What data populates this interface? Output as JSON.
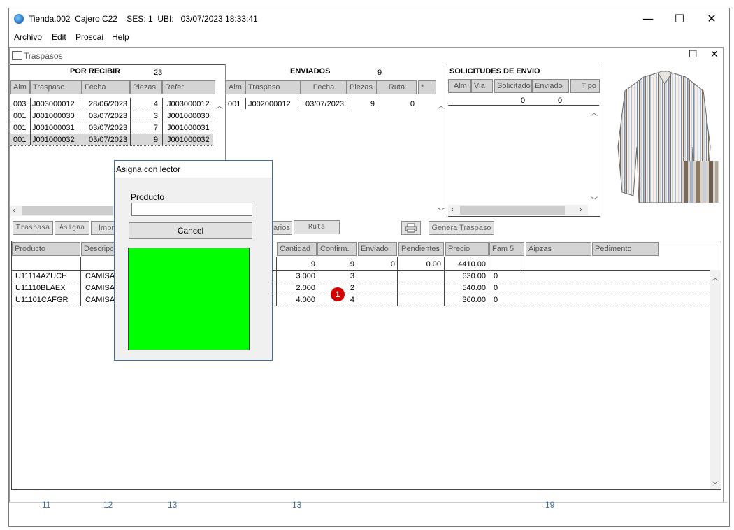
{
  "window": {
    "title": "Tienda.002  Cajero C22    SES: 1  UBI:   03/07/2023 18:33:41",
    "minimize": "—",
    "maximize": "☐",
    "close": "✕"
  },
  "menu": [
    "Archivo",
    "Edit",
    "Proscai",
    "Help"
  ],
  "child_window": {
    "title": "Traspasos",
    "maximize": "☐",
    "close": "✕"
  },
  "por_recibir": {
    "title": "POR RECIBIR",
    "count": "23",
    "headers": [
      "Alm",
      "Traspaso",
      "Fecha",
      "Piezas",
      "Refer"
    ],
    "rows": [
      [
        "003",
        "J003000012",
        "28/06/2023",
        "4",
        "J003000012"
      ],
      [
        "001",
        "J001000030",
        "03/07/2023",
        "3",
        "J001000030"
      ],
      [
        "001",
        "J001000031",
        "03/07/2023",
        "7",
        "J001000031"
      ],
      [
        "001",
        "J001000032",
        "03/07/2023",
        "9",
        "J001000032"
      ]
    ]
  },
  "enviados": {
    "title": "ENVIADOS",
    "count": "9",
    "headers": [
      "Alm.",
      "Traspaso",
      "Fecha",
      "Piezas",
      "Ruta",
      "*"
    ],
    "rows": [
      [
        "001",
        "J002000012",
        "03/07/2023",
        "9",
        "0"
      ]
    ]
  },
  "solicitudes": {
    "title": "SOLICITUDES DE ENVIO",
    "headers": [
      "Alm.",
      "Via",
      "Solicitado",
      "Enviado",
      "Tipo"
    ],
    "totals": [
      "0",
      "0"
    ]
  },
  "toolbar": {
    "traspasa": "Traspasa",
    "asigna": "Asigna",
    "imprime": "Impr",
    "varios": "arios",
    "ruta": "Ruta",
    "genera": "Genera Traspaso"
  },
  "detail": {
    "headers": [
      "Producto",
      "Descripc",
      "Cantidad",
      "Confirm.",
      "Enviado",
      "Pendientes",
      "Precio",
      "Fam 5",
      "Aipzas",
      "Pedimento"
    ],
    "totals": {
      "cantidad": "9",
      "confirm": "9",
      "enviado": "0",
      "pendientes": "0.00",
      "precio": "4410.00"
    },
    "rows": [
      {
        "producto": "U11114AZUCH",
        "desc": "CAMISA",
        "cantidad": "3.000",
        "confirm": "3",
        "precio": "630.00",
        "fam": "0"
      },
      {
        "producto": "U11110BLAEX",
        "desc": "CAMISA",
        "cantidad": "2.000",
        "confirm": "2",
        "precio": "540.00",
        "fam": "0"
      },
      {
        "producto": "U11101CAFGR",
        "desc": "CAMISA",
        "cantidad": "4.000",
        "confirm": "4",
        "precio": "360.00",
        "fam": "0"
      }
    ]
  },
  "dialog": {
    "title": "Asigna con lector",
    "label": "Producto",
    "input_value": "",
    "cancel": "Cancel"
  },
  "badge": "1",
  "footer_numbers": [
    "11",
    "12",
    "13",
    "13",
    "19"
  ],
  "colors": {
    "green": "#00ff00",
    "badge": "#d40000",
    "header_bg": "#d4d4d4",
    "selected_row": "#d8d8d8"
  }
}
